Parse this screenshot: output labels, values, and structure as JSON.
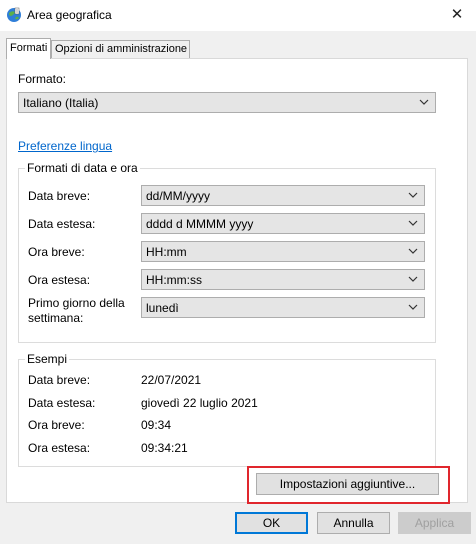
{
  "window": {
    "title": "Area geografica",
    "close_glyph": "✕"
  },
  "tabs": [
    {
      "label": "Formati",
      "active": true
    },
    {
      "label": "Opzioni di amministrazione",
      "active": false
    }
  ],
  "format": {
    "label": "Formato:",
    "value": "Italiano (Italia)"
  },
  "language_link": "Preferenze lingua",
  "date_time": {
    "title": "Formati di data e ora",
    "rows": [
      {
        "label": "Data breve:",
        "value": "dd/MM/yyyy"
      },
      {
        "label": "Data estesa:",
        "value": "dddd d MMMM yyyy"
      },
      {
        "label": "Ora breve:",
        "value": "HH:mm"
      },
      {
        "label": "Ora estesa:",
        "value": "HH:mm:ss"
      },
      {
        "label_line1": "Primo giorno della",
        "label_line2": "settimana:",
        "value": "lunedì"
      }
    ]
  },
  "examples": {
    "title": "Esempi",
    "rows": [
      {
        "label": "Data breve:",
        "value": "22/07/2021"
      },
      {
        "label": "Data estesa:",
        "value": "giovedì 22 luglio 2021"
      },
      {
        "label": "Ora breve:",
        "value": "09:34"
      },
      {
        "label": "Ora estesa:",
        "value": "09:34:21"
      }
    ]
  },
  "additional_settings_button": "Impostazioni aggiuntive...",
  "footer": {
    "ok": "OK",
    "cancel": "Annulla",
    "apply": "Applica"
  },
  "colors": {
    "link": "#0066cc",
    "highlight": "#e0262d",
    "default_button_border": "#0078d7"
  }
}
